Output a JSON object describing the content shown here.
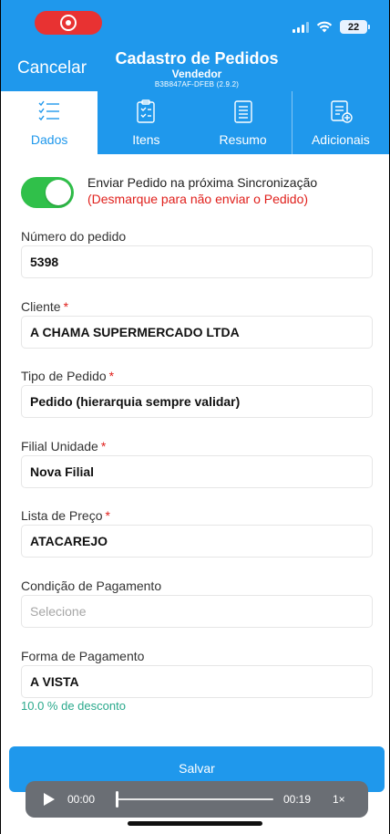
{
  "status_bar": {
    "battery": "22"
  },
  "header": {
    "cancel_label": "Cancelar",
    "title": "Cadastro de Pedidos",
    "subtitle": "Vendedor",
    "device_id": "B3B847AF-DFEB (2.9.2)"
  },
  "tabs": [
    {
      "label": "Dados",
      "icon": "checklist-icon",
      "active": true
    },
    {
      "label": "Itens",
      "icon": "clipboard-check-icon",
      "active": false
    },
    {
      "label": "Resumo",
      "icon": "document-list-icon",
      "active": false
    },
    {
      "label": "Adicionais",
      "icon": "document-plus-icon",
      "active": false
    }
  ],
  "sync": {
    "label": "Enviar Pedido na próxima Sincronização",
    "warning": "(Desmarque para não enviar o Pedido)",
    "enabled": true
  },
  "form": {
    "order_number": {
      "label": "Número do pedido",
      "value": "5398"
    },
    "client": {
      "label": "Cliente",
      "required_mark": "*",
      "value": "A CHAMA SUPERMERCADO LTDA"
    },
    "order_type": {
      "label": "Tipo de Pedido",
      "required_mark": "*",
      "value": "Pedido (hierarquia sempre validar)"
    },
    "branch": {
      "label": "Filial Unidade",
      "required_mark": "*",
      "value": "Nova Filial"
    },
    "price_list": {
      "label": "Lista de Preço",
      "required_mark": "*",
      "value": "ATACAREJO"
    },
    "payment_condition": {
      "label": "Condição de Pagamento",
      "placeholder": "Selecione"
    },
    "payment_method": {
      "label": "Forma de Pagamento",
      "value": "A VISTA",
      "hint": "10.0 % de desconto"
    }
  },
  "save_label": "Salvar",
  "player": {
    "current": "00:00",
    "duration": "00:19",
    "speed": "1×",
    "progress": 0.0
  },
  "colors": {
    "brand": "#1f98ec",
    "toggle_on": "#30c04a",
    "required": "#e0201c",
    "hint": "#2aa98c"
  }
}
